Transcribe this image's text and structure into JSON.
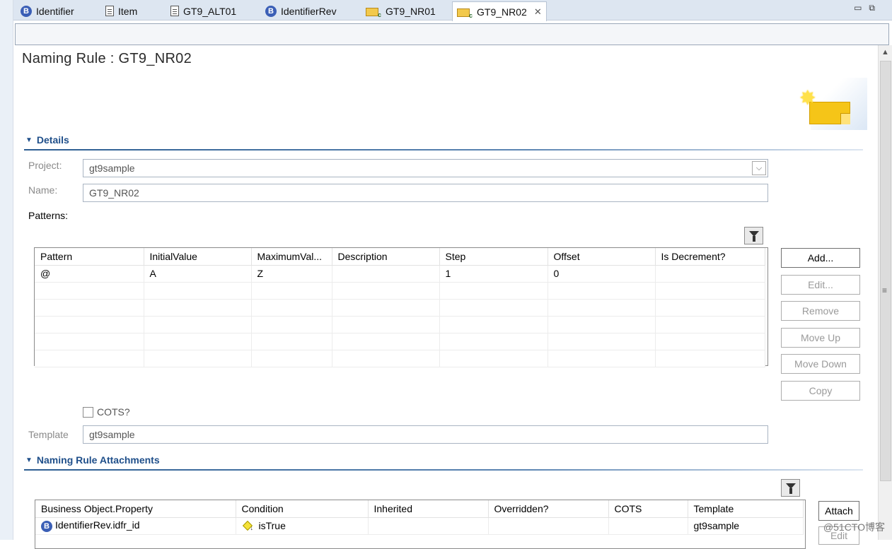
{
  "tabs": [
    {
      "label": "Identifier",
      "icon": "business-object-icon"
    },
    {
      "label": "Item",
      "icon": "document-icon"
    },
    {
      "label": "GT9_ALT01",
      "icon": "document-icon"
    },
    {
      "label": "IdentifierRev",
      "icon": "business-object-icon"
    },
    {
      "label": "GT9_NR01",
      "icon": "naming-rule-icon"
    },
    {
      "label": "GT9_NR02",
      "icon": "naming-rule-icon",
      "active": true
    }
  ],
  "page": {
    "title": "Naming Rule : GT9_NR02"
  },
  "details": {
    "header": "Details",
    "project_label": "Project:",
    "project_value": "gt9sample",
    "name_label": "Name:",
    "name_value": "GT9_NR02",
    "patterns_label": "Patterns:",
    "patterns_columns": [
      "Pattern",
      "InitialValue",
      "MaximumVal...",
      "Description",
      "Step",
      "Offset",
      "Is Decrement?"
    ],
    "patterns_rows": [
      [
        "@",
        "A",
        "Z",
        "",
        "1",
        "0",
        ""
      ],
      [
        "",
        "",
        "",
        "",
        "",
        "",
        ""
      ],
      [
        "",
        "",
        "",
        "",
        "",
        "",
        ""
      ],
      [
        "",
        "",
        "",
        "",
        "",
        "",
        ""
      ],
      [
        "",
        "",
        "",
        "",
        "",
        "",
        ""
      ],
      [
        "",
        "",
        "",
        "",
        "",
        "",
        ""
      ]
    ],
    "buttons": {
      "add": "Add...",
      "edit": "Edit...",
      "remove": "Remove",
      "move_up": "Move Up",
      "move_down": "Move Down",
      "copy": "Copy"
    },
    "cots_label": "COTS?",
    "cots_checked": false,
    "template_label": "Template",
    "template_value": "gt9sample"
  },
  "attachments": {
    "header": "Naming Rule Attachments",
    "columns": [
      "Business Object.Property",
      "Condition",
      "Inherited",
      "Overridden?",
      "COTS",
      "Template"
    ],
    "rows": [
      {
        "property": "IdentifierRev.idfr_id",
        "condition": "isTrue",
        "inherited": "",
        "overridden": "",
        "cots": "",
        "template": "gt9sample"
      }
    ],
    "attach_button": "Attach",
    "edit_button": "Edit"
  },
  "watermark": "@51CTO博客",
  "colors": {
    "section_header": "#1f4f8a",
    "tab_bar": "#dde6f1",
    "disabled_text": "#9a9a9a"
  }
}
